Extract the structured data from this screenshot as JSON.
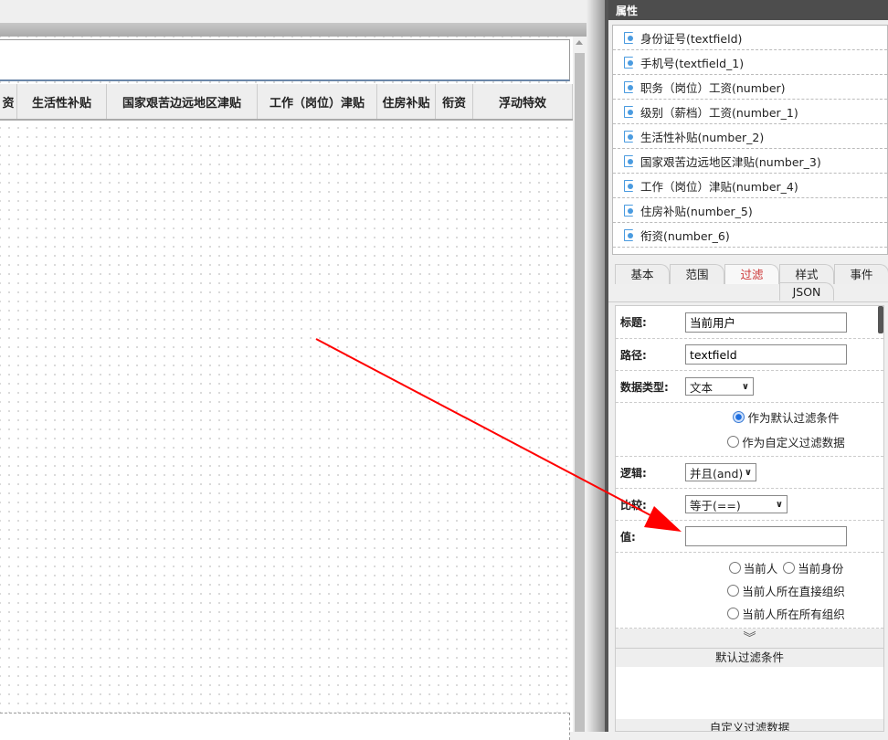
{
  "canvas": {
    "columns": [
      "资",
      "生活性补贴",
      "国家艰苦边远地区津贴",
      "工作（岗位）津贴",
      "住房补贴",
      "衔资",
      "浮动特效"
    ]
  },
  "panel": {
    "title": "属性",
    "fields": [
      "身份证号(textfield)",
      "手机号(textfield_1)",
      "职务（岗位）工资(number)",
      "级别（薪档）工资(number_1)",
      "生活性补贴(number_2)",
      "国家艰苦边远地区津贴(number_3)",
      "工作（岗位）津贴(number_4)",
      "住房补贴(number_5)",
      "衔资(number_6)"
    ],
    "tabs": [
      "基本",
      "范围",
      "过滤",
      "样式",
      "事件",
      "JSON"
    ],
    "active_tab": "过滤",
    "form": {
      "title_label": "标题:",
      "title_value": "当前用户",
      "path_label": "路径:",
      "path_value": "textfield",
      "type_label": "数据类型:",
      "type_value": "文本",
      "mode_options": [
        "作为默认过滤条件",
        "作为自定义过滤数据"
      ],
      "logic_label": "逻辑:",
      "logic_value": "并且(and)",
      "compare_label": "比较:",
      "compare_value": "等于(==)",
      "value_label": "值:",
      "value_value": "",
      "value_options": [
        "当前人",
        "当前身份",
        "当前人所在直接组织",
        "当前人所在所有组织"
      ],
      "default_section": "默认过滤条件",
      "custom_section": "自定义过滤数据"
    }
  },
  "colors": {
    "annotation_arrow": "#ff0000",
    "active_tab": "#cc3333"
  }
}
